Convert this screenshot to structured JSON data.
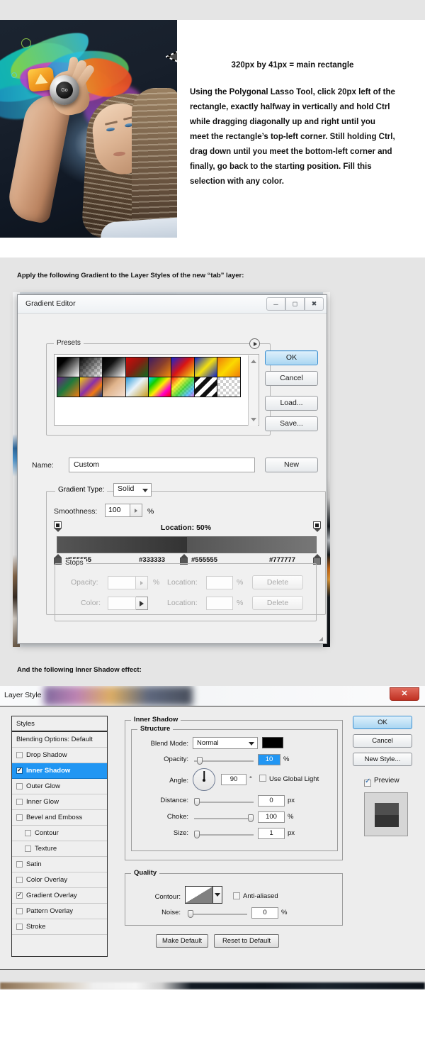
{
  "hero": {
    "caption_title": "320px by 41px = main rectangle",
    "caption_body": "Using the Polygonal Lasso Tool, click 20px left of the rectangle, exactly halfway in vertically and hold Ctrl while dragging diagonally up and right until you meet the rectangle’s top-left corner. Still holding Ctrl, drag down until you meet the bottom-left corner and finally, go back to the starting position. Fill this selection with any color.",
    "ball_label": "Go",
    "tab_fill_color": "#4a4a4a"
  },
  "notes": {
    "gradient": "Apply the following Gradient to the Layer Styles of the new “tab” layer:",
    "inner_shadow": "And the following Inner Shadow effect:"
  },
  "gradient_editor": {
    "title": "Gradient Editor",
    "window_buttons": [
      "minimize-icon",
      "maximize-icon",
      "close-icon"
    ],
    "presets_legend": "Presets",
    "preset_menu_icon": "preset-menu-arrow-icon",
    "scrollbar": {
      "up_icon": "scroll-up-icon",
      "down_icon": "scroll-down-icon"
    },
    "presets": [
      "black-white",
      "white-transparent",
      "black-white-2",
      "red-green",
      "violet-orange",
      "blue-red-yellow",
      "blue-yellow-blue",
      "orange-yellow-orange",
      "violet-green-orange",
      "yellow-violet-orange-blue",
      "copper",
      "chrome",
      "spectrum",
      "transparent-rainbow",
      "transparent-stripes",
      "neutral-density"
    ],
    "buttons": {
      "ok": "OK",
      "cancel": "Cancel",
      "load": "Load...",
      "save": "Save...",
      "new": "New"
    },
    "name_label": "Name:",
    "name_value": "Custom",
    "gradient_type_label": "Gradient Type:",
    "gradient_type_value": "Solid",
    "smoothness_label": "Smoothness:",
    "smoothness_value": "100",
    "smoothness_unit": "%",
    "location_readout": "Location: 50%",
    "color_stops": [
      {
        "hex": "#555555",
        "position": 0
      },
      {
        "hex": "#333333",
        "position": 50
      },
      {
        "hex": "#555555",
        "position": 50
      },
      {
        "hex": "#777777",
        "position": 100
      }
    ],
    "stops_legend": "Stops",
    "stops_rows": [
      {
        "label": "Opacity:",
        "value": "",
        "unit": "%",
        "loc_label": "Location:",
        "loc_value": "",
        "loc_unit": "%",
        "delete": "Delete"
      },
      {
        "label": "Color:",
        "value": "",
        "unit": "",
        "loc_label": "Location:",
        "loc_value": "",
        "loc_unit": "%",
        "delete": "Delete"
      }
    ]
  },
  "layer_style": {
    "title": "Layer Style",
    "close_label": "✕",
    "styles_header": "Styles",
    "styles": [
      {
        "label": "Blending Options: Default",
        "checkbox": null,
        "checked": false,
        "selected": false,
        "sub": false
      },
      {
        "label": "Drop Shadow",
        "checkbox": true,
        "checked": false,
        "selected": false,
        "sub": false
      },
      {
        "label": "Inner Shadow",
        "checkbox": true,
        "checked": true,
        "selected": true,
        "sub": false
      },
      {
        "label": "Outer Glow",
        "checkbox": true,
        "checked": false,
        "selected": false,
        "sub": false
      },
      {
        "label": "Inner Glow",
        "checkbox": true,
        "checked": false,
        "selected": false,
        "sub": false
      },
      {
        "label": "Bevel and Emboss",
        "checkbox": true,
        "checked": false,
        "selected": false,
        "sub": false
      },
      {
        "label": "Contour",
        "checkbox": true,
        "checked": false,
        "selected": false,
        "sub": true
      },
      {
        "label": "Texture",
        "checkbox": true,
        "checked": false,
        "selected": false,
        "sub": true
      },
      {
        "label": "Satin",
        "checkbox": true,
        "checked": false,
        "selected": false,
        "sub": false
      },
      {
        "label": "Color Overlay",
        "checkbox": true,
        "checked": false,
        "selected": false,
        "sub": false
      },
      {
        "label": "Gradient Overlay",
        "checkbox": true,
        "checked": true,
        "selected": false,
        "sub": false
      },
      {
        "label": "Pattern Overlay",
        "checkbox": true,
        "checked": false,
        "selected": false,
        "sub": false
      },
      {
        "label": "Stroke",
        "checkbox": true,
        "checked": false,
        "selected": false,
        "sub": false
      }
    ],
    "panel_title": "Inner Shadow",
    "structure_legend": "Structure",
    "blend_mode_label": "Blend Mode:",
    "blend_mode_value": "Normal",
    "blend_color": "#000000",
    "opacity_label": "Opacity:",
    "opacity_value": "10",
    "opacity_unit": "%",
    "angle_label": "Angle:",
    "angle_value": "90",
    "angle_unit": "°",
    "use_global_light": "Use Global Light",
    "use_global_light_checked": false,
    "distance_label": "Distance:",
    "distance_value": "0",
    "distance_unit": "px",
    "choke_label": "Choke:",
    "choke_value": "100",
    "choke_unit": "%",
    "size_label": "Size:",
    "size_value": "1",
    "size_unit": "px",
    "quality_legend": "Quality",
    "contour_label": "Contour:",
    "anti_aliased_label": "Anti-aliased",
    "anti_aliased_checked": false,
    "noise_label": "Noise:",
    "noise_value": "0",
    "noise_unit": "%",
    "make_default": "Make Default",
    "reset_to_default": "Reset to Default",
    "buttons": {
      "ok": "OK",
      "cancel": "Cancel",
      "new_style": "New Style..."
    },
    "preview_label": "Preview",
    "preview_checked": true,
    "selection_highlight_color": "#2196f3"
  }
}
